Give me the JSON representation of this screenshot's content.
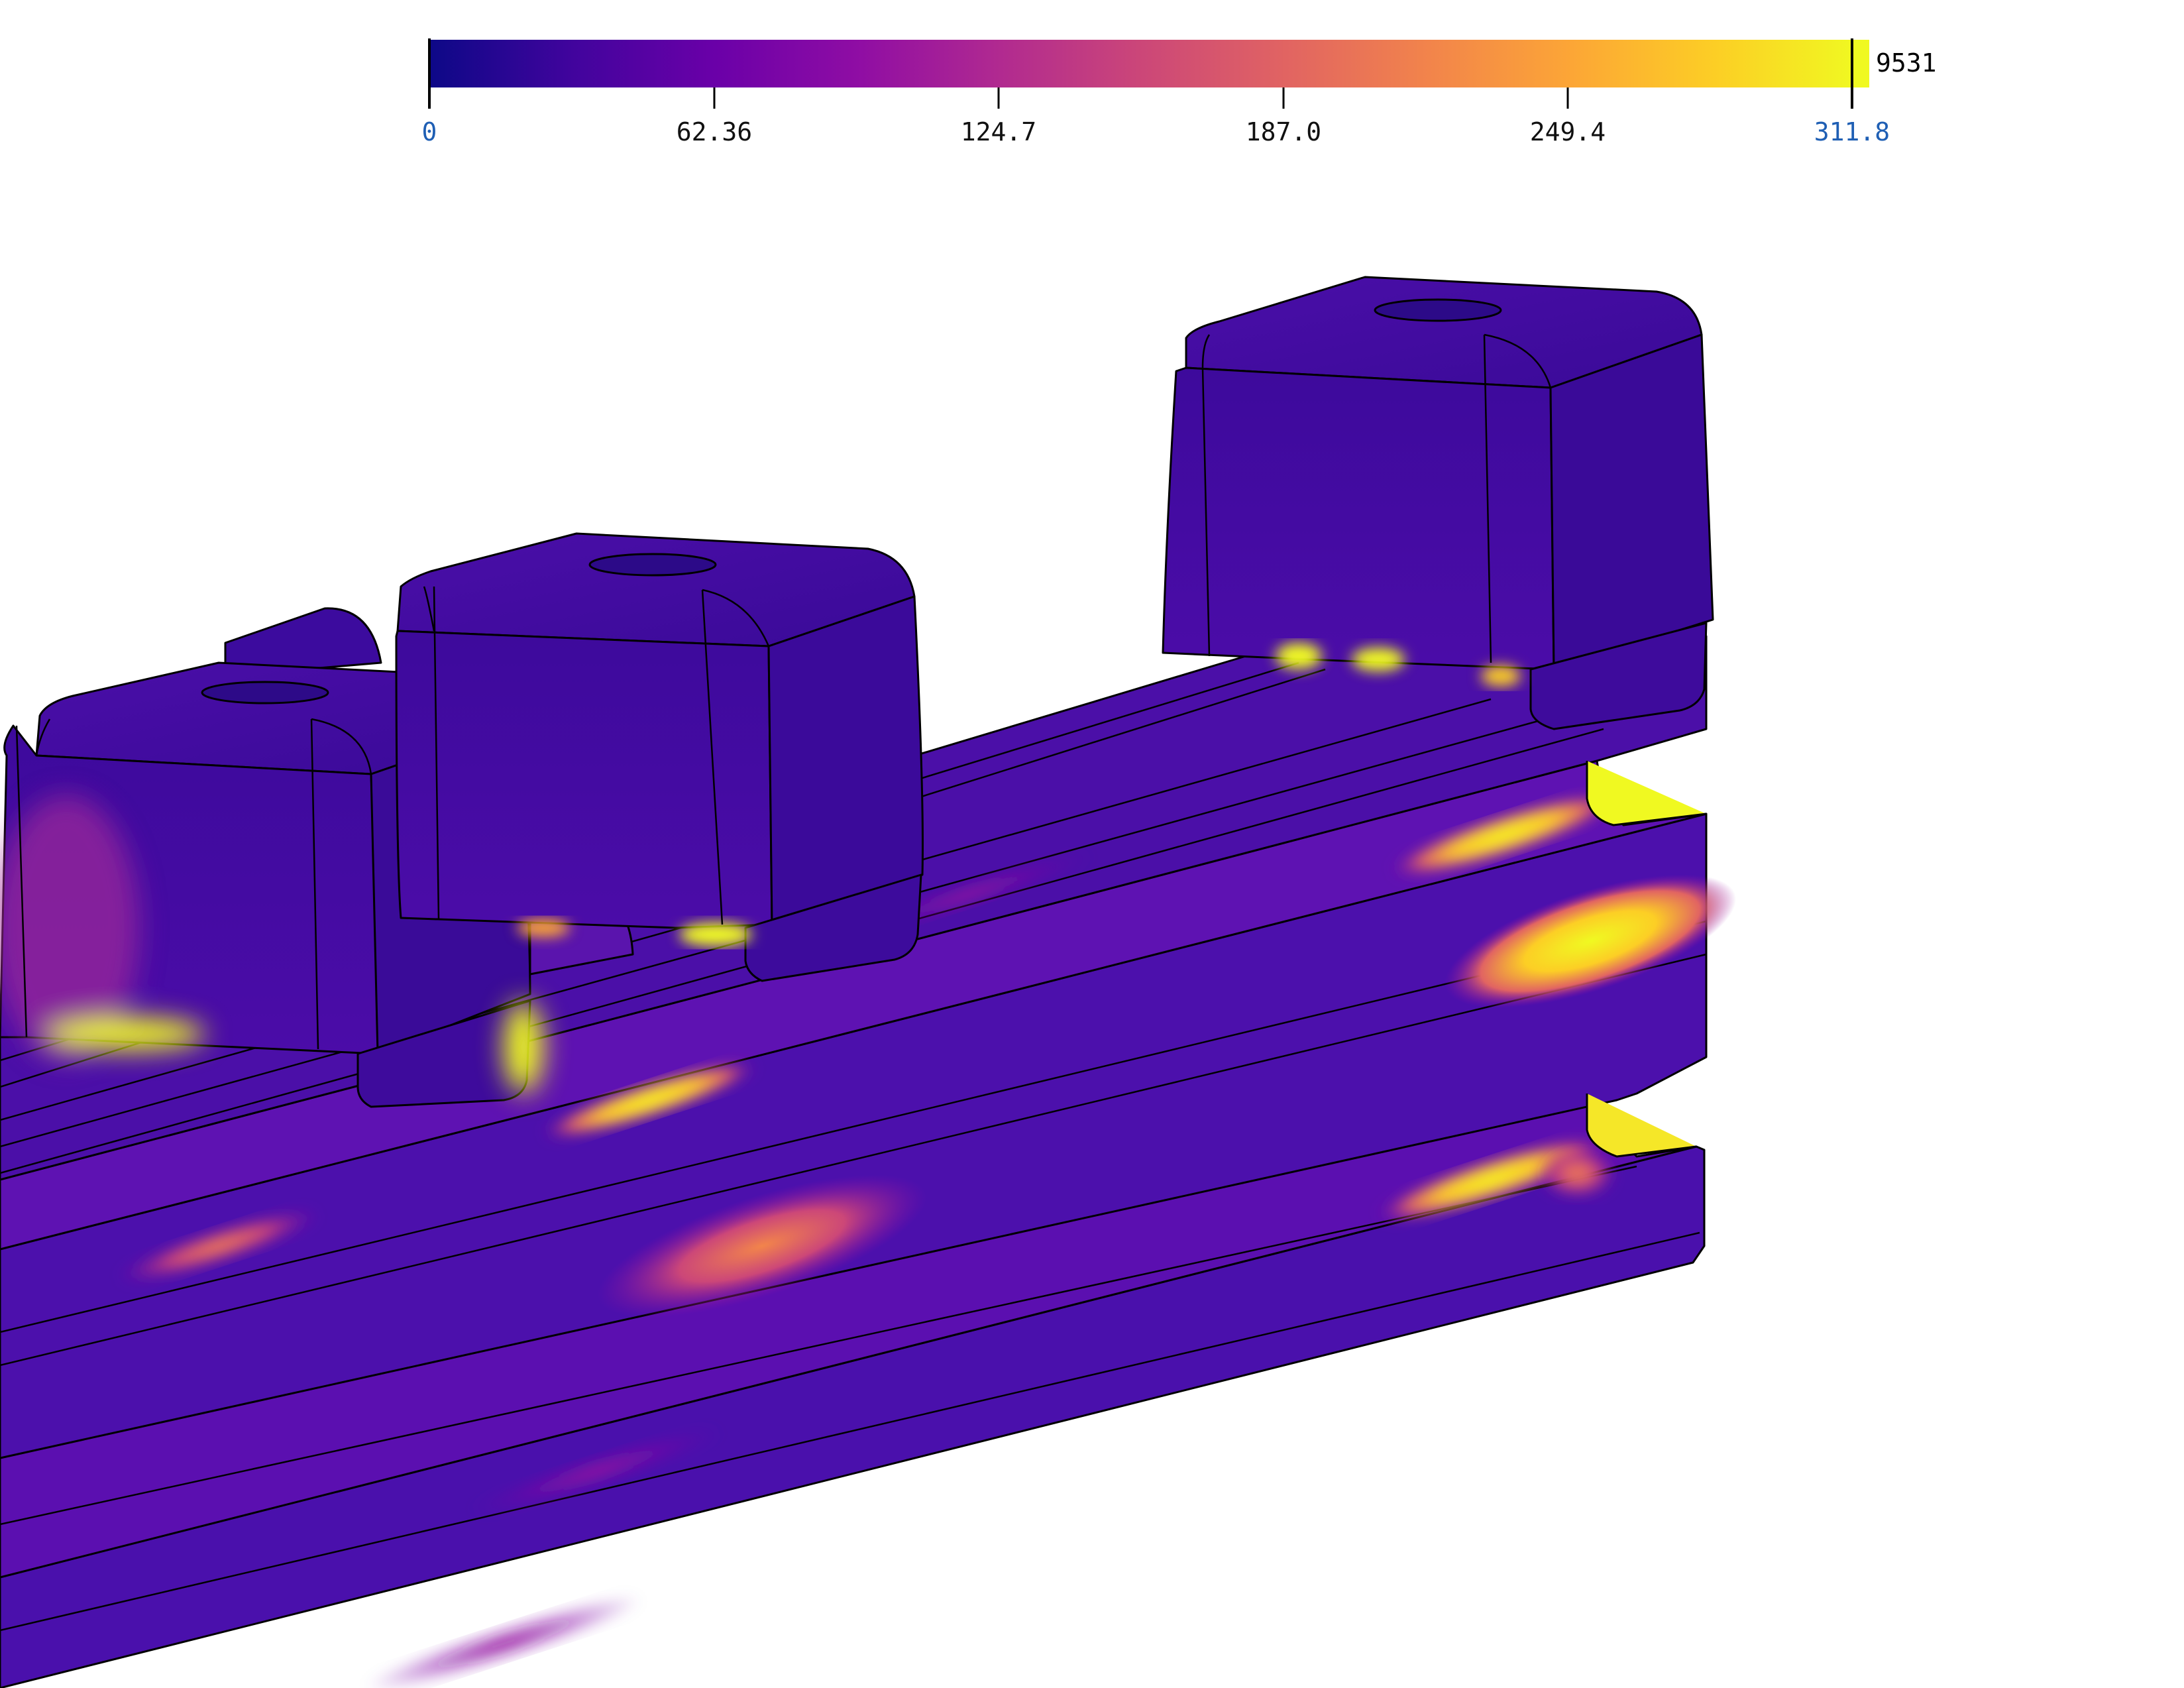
{
  "colorbar": {
    "min_label": "0",
    "max_label": "311.8",
    "overflow_label": "9531",
    "tick_labels": [
      "0",
      "62.36",
      "124.7",
      "187.0",
      "249.4",
      "311.8"
    ],
    "limit_label_color": "#1f5fb4",
    "tick_label_color": "#111111",
    "colormap": [
      "#0d0887",
      "#41049d",
      "#6a00a8",
      "#8f0da4",
      "#b12a90",
      "#cc4778",
      "#e16462",
      "#f2844b",
      "#fca636",
      "#fcce25",
      "#f0f921"
    ]
  },
  "colors": {
    "base_low": "#3a0ca3",
    "base_mid": "#5a10b0",
    "hot": "#f0f921",
    "warm": "#f2844b",
    "edge": "#000000"
  }
}
